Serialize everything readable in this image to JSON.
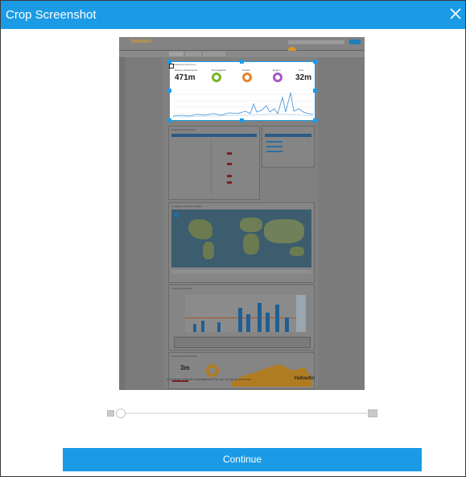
{
  "dialog": {
    "title": "Crop Screenshot",
    "continue_label": "Continue"
  },
  "preview": {
    "app_logo": "Yellowfin",
    "dashboard_title": "Dashboard Summary",
    "kpis": {
      "card1_label": "Delivery Attachments",
      "card1_value": "471m",
      "card2_label": "Demographic",
      "card3_label": "Gender",
      "card4_label": "Region",
      "card5_label": "Cost",
      "card5_value": "32m"
    },
    "sections": {
      "table_title": "Regional Performance",
      "map_title": "Campaign Visits by Location",
      "chart_title": "Invoice Per Period",
      "bottom_title": "Campaign Performance",
      "bottom_value": "3m"
    },
    "footer_left": "Copyright Yellowfin International Pty Ltd. All rights reserved.",
    "footer_right": "Yellowfin"
  },
  "colors": {
    "accent": "#1b9be6"
  }
}
